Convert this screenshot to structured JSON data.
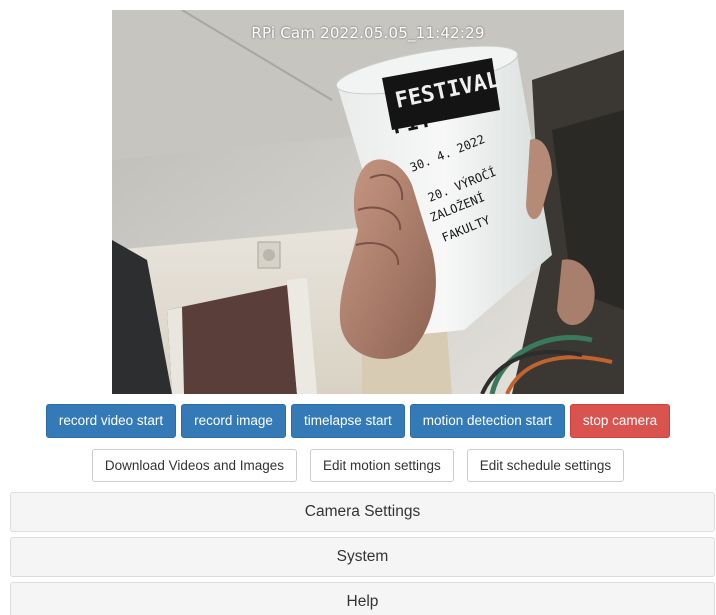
{
  "preview": {
    "overlay_text": "RPi Cam  2022.05.05_11:42:29"
  },
  "controls": {
    "primary": [
      {
        "label": "record video start"
      },
      {
        "label": "record image"
      },
      {
        "label": "timelapse start"
      },
      {
        "label": "motion detection start"
      },
      {
        "label": "stop camera"
      }
    ],
    "secondary": [
      {
        "label": "Download Videos and Images"
      },
      {
        "label": "Edit motion settings"
      },
      {
        "label": "Edit schedule settings"
      }
    ]
  },
  "panels": {
    "camera_settings": "Camera Settings",
    "system": "System",
    "help": "Help"
  },
  "colors": {
    "primary": "#337ab7",
    "danger": "#d9534f",
    "panel_bg": "#f5f5f5"
  }
}
